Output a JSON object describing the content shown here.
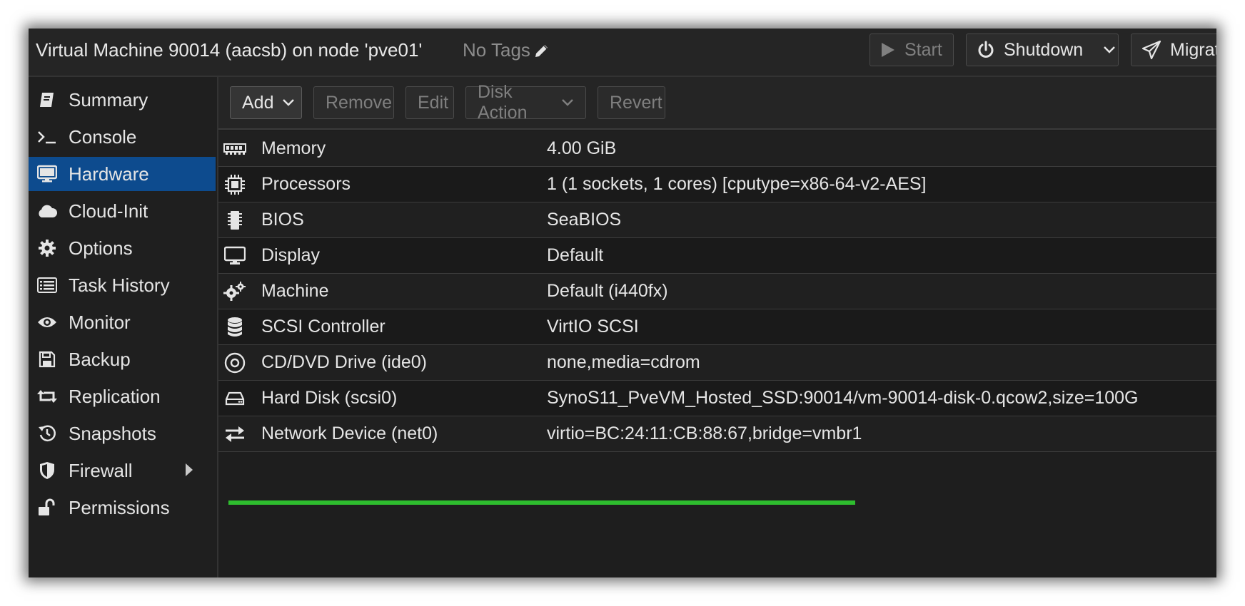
{
  "header": {
    "title": "Virtual Machine 90014 (aacsb) on node 'pve01'",
    "tags_label": "No Tags",
    "start_label": "Start",
    "shutdown_label": "Shutdown",
    "migrate_label": "Migrate"
  },
  "sidebar": {
    "items": [
      {
        "label": "Summary",
        "icon": "book-icon"
      },
      {
        "label": "Console",
        "icon": "terminal-icon"
      },
      {
        "label": "Hardware",
        "icon": "monitor-icon",
        "active": true
      },
      {
        "label": "Cloud-Init",
        "icon": "cloud-icon"
      },
      {
        "label": "Options",
        "icon": "gear-icon"
      },
      {
        "label": "Task History",
        "icon": "list-icon"
      },
      {
        "label": "Monitor",
        "icon": "eye-icon"
      },
      {
        "label": "Backup",
        "icon": "floppy-icon"
      },
      {
        "label": "Replication",
        "icon": "retweet-icon"
      },
      {
        "label": "Snapshots",
        "icon": "history-icon"
      },
      {
        "label": "Firewall",
        "icon": "shield-icon"
      },
      {
        "label": "Permissions",
        "icon": "unlock-icon"
      }
    ]
  },
  "toolbar": {
    "add_label": "Add",
    "remove_label": "Remove",
    "edit_label": "Edit",
    "disk_action_label": "Disk Action",
    "revert_label": "Revert"
  },
  "hardware": {
    "rows": [
      {
        "name": "Memory",
        "value": "4.00 GiB",
        "icon": "memory-icon"
      },
      {
        "name": "Processors",
        "value": "1 (1 sockets, 1 cores) [cputype=x86-64-v2-AES]",
        "icon": "cpu-icon"
      },
      {
        "name": "BIOS",
        "value": "SeaBIOS",
        "icon": "microchip-icon"
      },
      {
        "name": "Display",
        "value": "Default",
        "icon": "desktop-icon"
      },
      {
        "name": "Machine",
        "value": "Default (i440fx)",
        "icon": "cogs-icon"
      },
      {
        "name": "SCSI Controller",
        "value": "VirtIO SCSI",
        "icon": "database-icon"
      },
      {
        "name": "CD/DVD Drive (ide0)",
        "value": "none,media=cdrom",
        "icon": "cdrom-icon"
      },
      {
        "name": "Hard Disk (scsi0)",
        "value": "SynoS11_PveVM_Hosted_SSD:90014/vm-90014-disk-0.qcow2,size=100G",
        "icon": "hdd-icon"
      },
      {
        "name": "Network Device (net0)",
        "value": "virtio=BC:24:11:CB:88:67,bridge=vmbr1",
        "icon": "exchange-icon"
      }
    ]
  },
  "colors": {
    "active_nav": "#0d4b8e",
    "highlight": "#2ebd2e",
    "background": "#1e1e1e"
  }
}
